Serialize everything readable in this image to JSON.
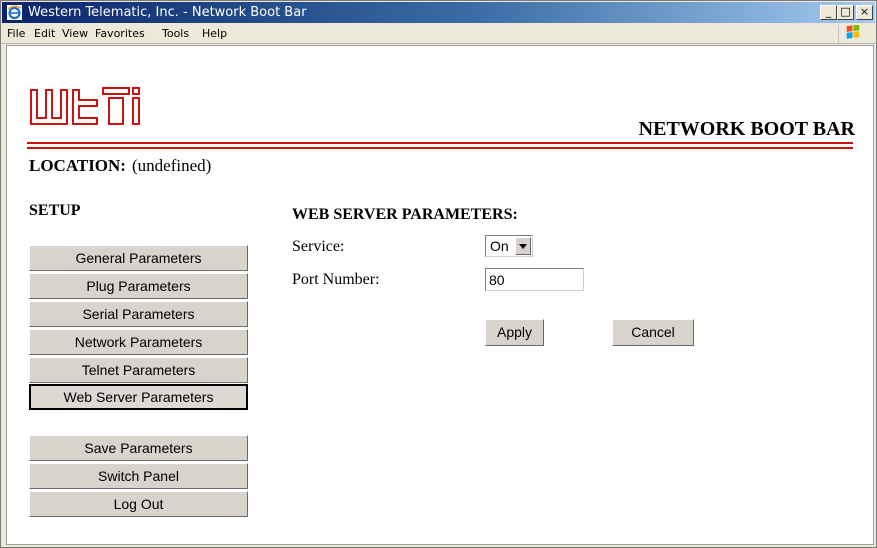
{
  "window": {
    "title": "Western Telematic, Inc. - Network Boot Bar",
    "controls": {
      "minimize": "_",
      "maximize": "□",
      "close": "×"
    }
  },
  "menu": [
    "File",
    "Edit",
    "View",
    "Favorites",
    "Tools",
    "Help"
  ],
  "header": {
    "logo_text": "wti",
    "product_title": "NETWORK BOOT BAR",
    "brand_color": "#cc1111"
  },
  "location": {
    "label": "LOCATION:",
    "value": "(undefined)"
  },
  "sidebar": {
    "heading": "SETUP",
    "setup_items": [
      {
        "label": "General Parameters"
      },
      {
        "label": "Plug Parameters"
      },
      {
        "label": "Serial Parameters"
      },
      {
        "label": "Network Parameters"
      },
      {
        "label": "Telnet Parameters"
      },
      {
        "label": "Web Server Parameters",
        "selected": true
      }
    ],
    "action_items": [
      {
        "label": "Save Parameters"
      },
      {
        "label": "Switch Panel"
      },
      {
        "label": "Log Out"
      }
    ]
  },
  "main": {
    "section_title": "WEB SERVER PARAMETERS:",
    "service": {
      "label": "Service:",
      "value": "On"
    },
    "port": {
      "label": "Port Number:",
      "value": "80"
    },
    "buttons": {
      "apply": "Apply",
      "cancel": "Cancel"
    }
  }
}
